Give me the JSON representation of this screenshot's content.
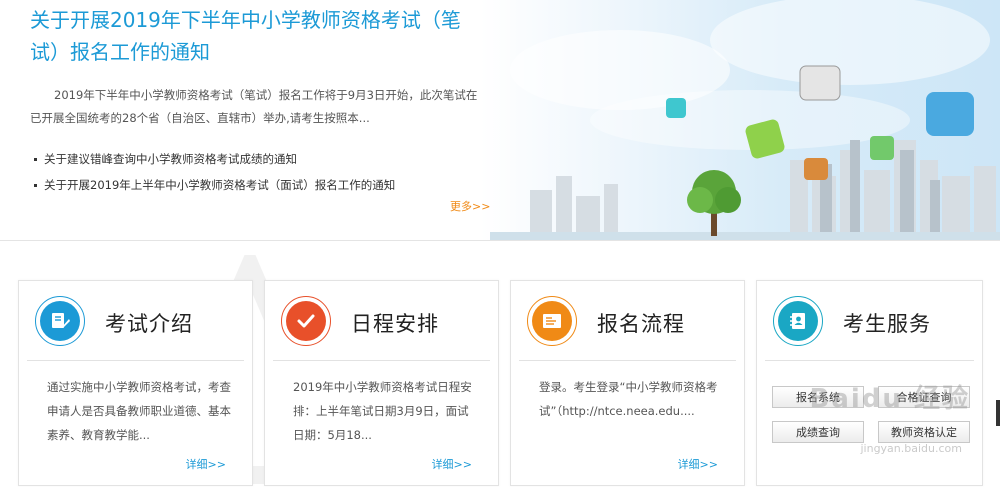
{
  "hero": {
    "headline": "关于开展2019年下半年中小学教师资格考试（笔试）报名工作的通知",
    "summary": "2019年下半年中小学教师资格考试（笔试）报名工作将于9月3日开始，此次笔试在已开展全国统考的28个省（自治区、直辖市）举办,请考生按照本...",
    "news": [
      "关于建议错峰查询中小学教师资格考试成绩的通知",
      "关于开展2019年上半年中小学教师资格考试（面试）报名工作的通知"
    ],
    "more": "更多>>"
  },
  "cards": [
    {
      "title": "考试介绍",
      "desc": "通过实施中小学教师资格考试，考查申请人是否具备教师职业道德、基本素养、教育教学能...",
      "detail": "详细>>",
      "accent": "#1c9ad6",
      "icon": "document-pen-icon"
    },
    {
      "title": "日程安排",
      "desc": "2019年中小学教师资格考试日程安排：上半年笔试日期3月9日，面试日期：5月18...",
      "detail": "详细>>",
      "accent": "#e8502a",
      "icon": "checkmark-icon"
    },
    {
      "title": "报名流程",
      "desc": "登录。考生登录“中小学教师资格考试”（http://ntce.neea.edu....",
      "detail": "详细>>",
      "accent": "#f08a16",
      "icon": "form-icon"
    },
    {
      "title": "考生服务",
      "accent": "#1aa7c4",
      "icon": "contact-book-icon",
      "buttons": [
        "报名系统",
        "合格证查询",
        "成绩查询",
        "教师资格认定"
      ]
    }
  ],
  "watermark": {
    "brand": "Baidu 经验",
    "url": "jingyan.baidu.com"
  }
}
